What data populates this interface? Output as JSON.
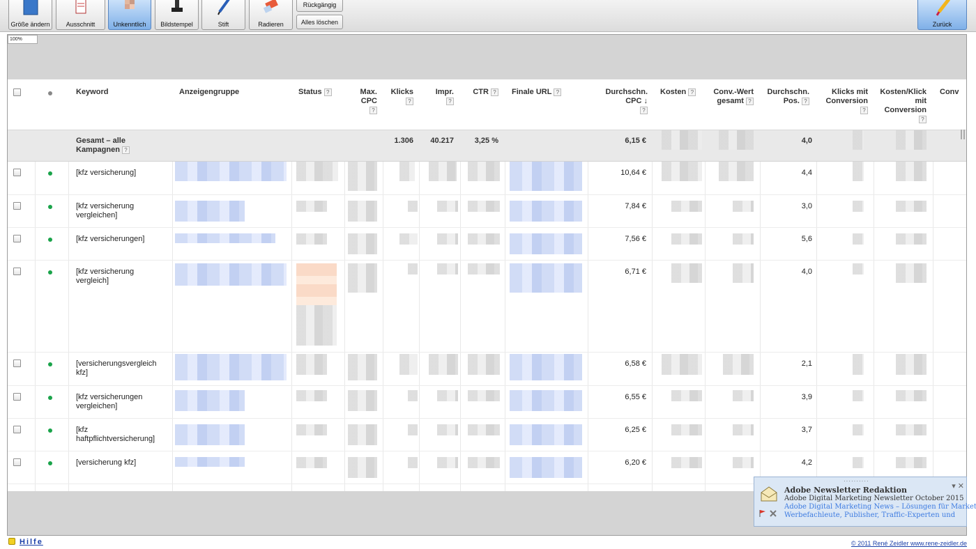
{
  "toolbar": {
    "resize": "Größe ändern",
    "crop": "Ausschnitt",
    "blur": "Unkenntlich",
    "stamp": "Bildstempel",
    "pen": "Stift",
    "eraser": "Radieren",
    "undo": "Rückgängig",
    "clear_all": "Alles löschen",
    "back": "Zurück"
  },
  "zoom_level": "100%",
  "table": {
    "headers": {
      "keyword": "Keyword",
      "ad_group": "Anzeigengruppe",
      "status": "Status",
      "max_cpc": "Max. CPC",
      "clicks": "Klicks",
      "impressions": "Impr.",
      "ctr": "CTR",
      "final_url": "Finale URL",
      "avg_cpc": "Durchschn. CPC",
      "cost": "Kosten",
      "conv_value": "Conv.-Wert gesamt",
      "avg_pos": "Durchschn. Pos.",
      "conv_clicks": "Klicks mit Conversion",
      "cost_per_conv_click": "Kosten/Klick mit Conversion",
      "conv_partial": "Conv"
    },
    "help_mark": "?",
    "sort_arrow": "↓",
    "total": {
      "label": "Gesamt – alle Kampagnen",
      "clicks": "1.306",
      "impressions": "40.217",
      "ctr": "3,25 %",
      "avg_cpc": "6,15 €",
      "avg_pos": "4,0"
    },
    "rows": [
      {
        "keyword": "[kfz versicherung]",
        "avg_cpc": "10,64 €",
        "avg_pos": "4,4"
      },
      {
        "keyword": "[kfz versicherung vergleichen]",
        "avg_cpc": "7,84 €",
        "avg_pos": "3,0"
      },
      {
        "keyword": "[kfz versicherungen]",
        "avg_cpc": "7,56 €",
        "avg_pos": "5,6"
      },
      {
        "keyword": "[kfz versicherung vergleich]",
        "avg_cpc": "6,71 €",
        "avg_pos": "4,0"
      },
      {
        "keyword": "[versicherungsvergleich kfz]",
        "avg_cpc": "6,58 €",
        "avg_pos": "2,1"
      },
      {
        "keyword": "[kfz versicherungen vergleichen]",
        "avg_cpc": "6,55 €",
        "avg_pos": "3,9"
      },
      {
        "keyword": "[kfz haftpflichtversicherung]",
        "avg_cpc": "6,25 €",
        "avg_pos": "3,7"
      },
      {
        "keyword": "[versicherung kfz]",
        "avg_cpc": "6,20 €",
        "avg_pos": "4,2"
      }
    ]
  },
  "notification": {
    "grip": "··········",
    "title": "Adobe Newsletter Redaktion",
    "line1": "Adobe Digital Marketing Newsletter October 2015",
    "line2": "Adobe Digital Marketing News – Lösungen für Marketer,",
    "line3": "Werbefachleute, Publisher, Traffic-Experten und",
    "close": "▾ ✕"
  },
  "footer": {
    "help": "Hilfe",
    "copyright": "© 2011 René Zeidler www.rene-zeidler.de"
  },
  "colors": {
    "active_tool": "#7fb0e8",
    "status_dot": "#1aa34a",
    "link": "#1a3fa8"
  }
}
